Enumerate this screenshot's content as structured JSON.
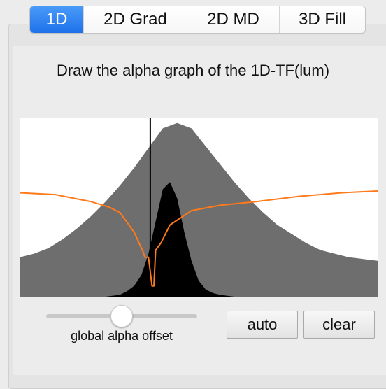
{
  "tabs": [
    {
      "label": "1D",
      "active": true
    },
    {
      "label": "2D Grad",
      "active": false
    },
    {
      "label": "2D MD",
      "active": false
    },
    {
      "label": "3D Fill",
      "active": false
    }
  ],
  "instruction": "Draw the alpha graph of the 1D-TF(lum)",
  "slider": {
    "label": "global alpha offset",
    "value": 0.5
  },
  "buttons": {
    "auto": "auto",
    "clear": "clear"
  },
  "colors": {
    "tab_active": "#2b7ff0",
    "histogram_fill": "#6e6e6e",
    "histogram_overlay": "#000000",
    "alpha_curve": "#ff7a1a",
    "graph_background": "#ffffff"
  },
  "chart_data": {
    "type": "area",
    "x_range": [
      0,
      1
    ],
    "y_range": [
      0,
      1
    ],
    "series": [
      {
        "role": "histogram-gray",
        "x": [
          0,
          0.04,
          0.08,
          0.12,
          0.16,
          0.2,
          0.24,
          0.28,
          0.32,
          0.36,
          0.4,
          0.44,
          0.48,
          0.52,
          0.56,
          0.6,
          0.64,
          0.68,
          0.72,
          0.76,
          0.8,
          0.84,
          0.88,
          0.92,
          0.96,
          1
        ],
        "y": [
          0.22,
          0.24,
          0.27,
          0.32,
          0.38,
          0.45,
          0.53,
          0.62,
          0.72,
          0.83,
          0.94,
          0.97,
          0.94,
          0.84,
          0.74,
          0.64,
          0.55,
          0.47,
          0.4,
          0.35,
          0.3,
          0.26,
          0.24,
          0.22,
          0.21,
          0.2
        ]
      },
      {
        "role": "histogram-black",
        "x": [
          0.24,
          0.28,
          0.3,
          0.32,
          0.34,
          0.36,
          0.38,
          0.4,
          0.42,
          0.44,
          0.46,
          0.48,
          0.5,
          0.52,
          0.54,
          0.56,
          0.58,
          0.6
        ],
        "y": [
          0.0,
          0.01,
          0.03,
          0.06,
          0.12,
          0.24,
          0.42,
          0.6,
          0.64,
          0.55,
          0.36,
          0.2,
          0.09,
          0.04,
          0.02,
          0.01,
          0.005,
          0.0
        ]
      },
      {
        "role": "alpha-curve",
        "x": [
          0,
          0.1,
          0.2,
          0.25,
          0.28,
          0.32,
          0.345,
          0.35,
          0.36,
          0.37,
          0.375,
          0.38,
          0.395,
          0.42,
          0.48,
          0.56,
          0.66,
          0.78,
          0.9,
          1
        ],
        "y": [
          0.58,
          0.57,
          0.53,
          0.5,
          0.47,
          0.36,
          0.25,
          0.22,
          0.22,
          0.06,
          0.06,
          0.26,
          0.3,
          0.4,
          0.48,
          0.51,
          0.53,
          0.56,
          0.58,
          0.59
        ]
      },
      {
        "role": "marker-line",
        "x": [
          0.365,
          0.365
        ],
        "y": [
          0,
          1
        ]
      }
    ]
  }
}
